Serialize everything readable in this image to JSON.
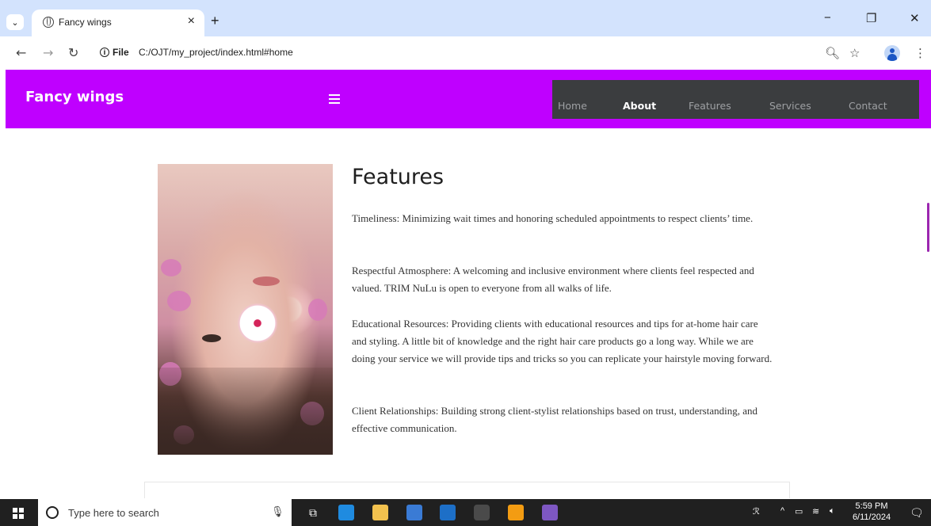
{
  "browser": {
    "tab_title": "Fancy wings",
    "tab_close": "×",
    "new_tab": "+",
    "file_chip": "File",
    "url": "C:/OJT/my_project/index.html#home",
    "minimize": "−",
    "restore": "❐",
    "close": "✕"
  },
  "site": {
    "brand": "Fancy wings",
    "nav": [
      "Home",
      "About",
      "Features",
      "Services",
      "Contact"
    ],
    "active_nav": "About",
    "header_color": "#bf00ff",
    "menu_bg": "#3b3d3f"
  },
  "content": {
    "title": "Features",
    "paragraphs": [
      "Timeliness: Minimizing wait times and honoring scheduled appointments to respect clients’ time.",
      "Respectful Atmosphere: A welcoming and inclusive environment where clients feel respected and valued. TRIM NuLu is open to everyone from all walks of life.",
      "Educational Resources: Providing clients with educational resources and tips for at-home hair care and styling. A little bit of knowledge and the right hair care products go a long way. While we are doing your service we will provide tips and tricks so you can replicate your hairstyle moving forward.",
      "Client Relationships: Building strong client-stylist relationships based on trust, understanding, and effective communication."
    ]
  },
  "taskbar": {
    "search_placeholder": "Type here to search",
    "time": "5:59 PM",
    "date": "6/11/2024"
  }
}
